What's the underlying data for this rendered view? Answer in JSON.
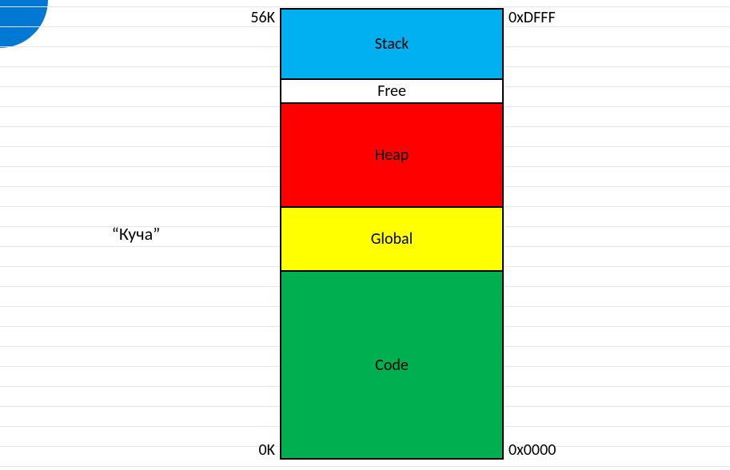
{
  "caption": "“Куча”",
  "labels": {
    "topLeft": "56K",
    "bottomLeft": "0K",
    "topRight": "0xDFFF",
    "bottomRight": "0x0000"
  },
  "segments": {
    "stack": "Stack",
    "free": "Free",
    "heap": "Heap",
    "global": "Global",
    "code": "Code"
  },
  "chart_data": {
    "type": "table",
    "title": "Memory layout",
    "address_range": {
      "low": "0x0000",
      "high": "0xDFFF",
      "size_kb": 56
    },
    "segments_top_to_bottom": [
      {
        "name": "Stack",
        "color": "#00b0f0"
      },
      {
        "name": "Free",
        "color": "#ffffff"
      },
      {
        "name": "Heap",
        "color": "#ff0000"
      },
      {
        "name": "Global",
        "color": "#ffff00"
      },
      {
        "name": "Code",
        "color": "#00b050"
      }
    ],
    "annotation": "“Куча”"
  }
}
